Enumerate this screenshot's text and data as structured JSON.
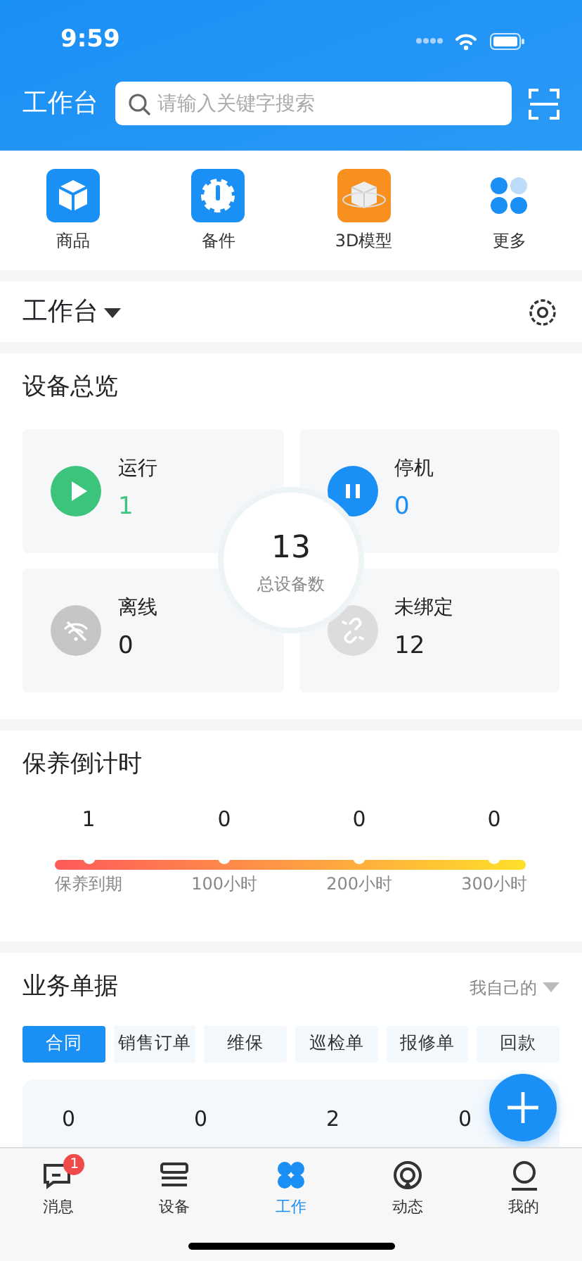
{
  "status_bar": {
    "time": "9:59"
  },
  "header": {
    "title": "工作台",
    "search": {
      "placeholder": "请输入关键字搜索"
    }
  },
  "quick_links": [
    {
      "label": "商品"
    },
    {
      "label": "备件"
    },
    {
      "label": "3D模型"
    },
    {
      "label": "更多"
    }
  ],
  "workbench": {
    "title": "工作台"
  },
  "overview": {
    "title": "设备总览",
    "total": "13",
    "total_label": "总设备数",
    "stats": [
      {
        "kind": "running",
        "label": "运行",
        "value": "1"
      },
      {
        "kind": "stopped",
        "label": "停机",
        "value": "0"
      },
      {
        "kind": "offline",
        "label": "离线",
        "value": "0"
      },
      {
        "kind": "unbound",
        "label": "未绑定",
        "value": "12"
      }
    ]
  },
  "maintenance": {
    "title": "保养倒计时",
    "milestones": [
      {
        "count": "1",
        "label": "保养到期"
      },
      {
        "count": "0",
        "label": "100小时"
      },
      {
        "count": "0",
        "label": "200小时"
      },
      {
        "count": "0",
        "label": "300小时"
      }
    ]
  },
  "documents": {
    "title": "业务单据",
    "filter": "我自己的",
    "tabs": [
      {
        "label": "合同",
        "selected": true
      },
      {
        "label": "销售订单",
        "selected": false
      },
      {
        "label": "维保",
        "selected": false
      },
      {
        "label": "巡检单",
        "selected": false
      },
      {
        "label": "报修单",
        "selected": false
      },
      {
        "label": "回款",
        "selected": false
      }
    ],
    "stats": [
      "0",
      "0",
      "2",
      "0"
    ]
  },
  "tab_bar": [
    {
      "label": "消息",
      "badge": "1",
      "selected": false
    },
    {
      "label": "设备",
      "selected": false
    },
    {
      "label": "工作",
      "selected": true
    },
    {
      "label": "动态",
      "selected": false
    },
    {
      "label": "我的",
      "selected": false
    }
  ]
}
